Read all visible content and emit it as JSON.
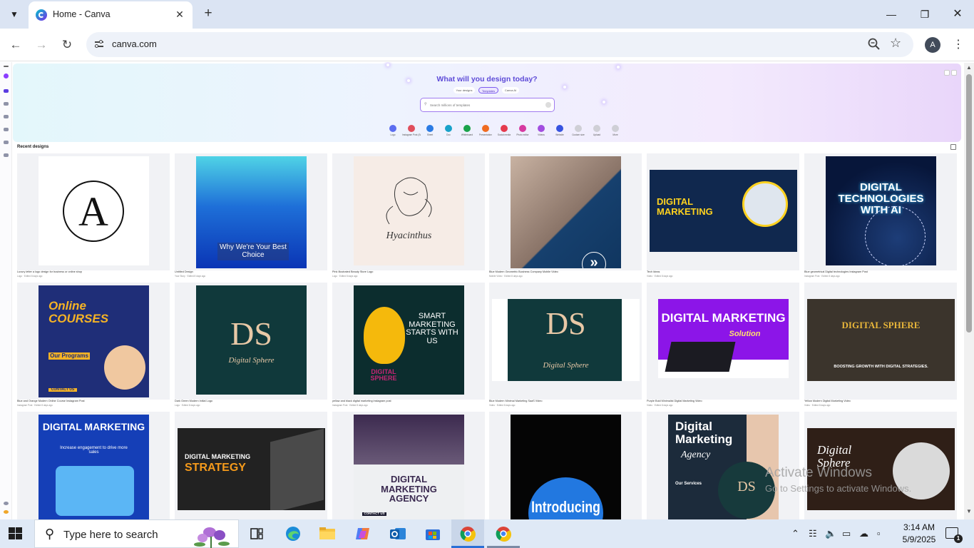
{
  "browser": {
    "tab_title": "Home - Canva",
    "url": "canva.com",
    "avatar_letter": "A"
  },
  "hero": {
    "heading": "What will you design today?",
    "tabs": [
      "Your designs",
      "Templates",
      "Canva AI"
    ],
    "search_placeholder": "Search millions of templates",
    "categories": [
      {
        "label": "Logo",
        "color": "#5b6df0"
      },
      {
        "label": "Instagram Post (Square)",
        "color": "#e04e5c"
      },
      {
        "label": "Sheet",
        "color": "#2a7be4"
      },
      {
        "label": "Doc",
        "color": "#17a2c9"
      },
      {
        "label": "Whiteboard",
        "color": "#1aa34a"
      },
      {
        "label": "Presentation",
        "color": "#f06b20"
      },
      {
        "label": "Social media",
        "color": "#e53a4d"
      },
      {
        "label": "Photo editor",
        "color": "#d63aa0"
      },
      {
        "label": "Videos",
        "color": "#a24ee0"
      },
      {
        "label": "Website",
        "color": "#3653e0"
      },
      {
        "label": "Custom size",
        "color": "#cfcfd6"
      },
      {
        "label": "Upload",
        "color": "#cfcfd6"
      },
      {
        "label": "More",
        "color": "#cfcfd6"
      }
    ]
  },
  "recent": {
    "title": "Recent designs",
    "designs": [
      {
        "name": "Luxury letter a logo design for business or online shop",
        "meta": "Logo · Edited 8 days ago",
        "art": "monogram-a"
      },
      {
        "name": "Untitled Design",
        "meta": "Your Story · Edited 8 days ago",
        "art": "blue-gradient",
        "caption": "Why We're Your Best Choice"
      },
      {
        "name": "Pink Illustrated Beauty Store Logo",
        "meta": "Logo · Edited 8 days ago",
        "art": "sketch",
        "signature": "Hyacinthus"
      },
      {
        "name": "Blue Modern Geometric Business Company Mobile Video",
        "meta": "Mobile Video · Edited 8 days ago",
        "art": "laptop-hands"
      },
      {
        "name": "Tech Ideas",
        "meta": "Video · Edited 8 days ago",
        "art": "dm-navy",
        "caption": "DIGITAL MARKETING"
      },
      {
        "name": "Blue geometrical Digital technologies Instagram Post",
        "meta": "Instagram Post · Edited 8 days ago",
        "art": "globe",
        "caption": "DIGITAL TECHNOLOGIES WITH AI"
      },
      {
        "name": "Blue and Orange Modern Online Course Instagram Post",
        "meta": "Instagram Post · Edited 8 days ago",
        "art": "online-courses",
        "caption": "Online COURSES",
        "sub": "Our Programs",
        "cta": "CONTACT US"
      },
      {
        "name": "Dark Green Modern Initial Logo",
        "meta": "Logo · Edited 8 days ago",
        "art": "ds-logo",
        "caption": "Digital Sphere"
      },
      {
        "name": "yellow and black digital marketing instagram post",
        "meta": "Instagram Post · Edited 8 days ago",
        "art": "bulb",
        "caption": "SMART MARKETING STARTS WITH US",
        "sub": "DIGITAL SPHERE"
      },
      {
        "name": "Blue Modern Minimal Marketing SaaS Video",
        "meta": "Video · Edited 8 days ago",
        "art": "ds-wide",
        "caption": "Digital Sphere"
      },
      {
        "name": "Purple Bold Minimalist Digital Marketing Video",
        "meta": "Video · Edited 8 days ago",
        "art": "purple-laptop",
        "caption": "DIGITAL MARKETING",
        "sub": "Solution"
      },
      {
        "name": "Yellow Modern Digital Marketing Video",
        "meta": "Video · Edited 8 days ago",
        "art": "gold-dark",
        "caption": "DIGITAL SPHERE",
        "sub": "BOOSTING GROWTH WITH DIGITAL STRATEGIES."
      },
      {
        "name": "",
        "meta": "",
        "art": "dm-blue",
        "caption": "DIGITAL MARKETING",
        "sub": "Increase engagement to drive more sales"
      },
      {
        "name": "",
        "meta": "",
        "art": "strategy",
        "caption": "DIGITAL MARKETING",
        "sub": "STRATEGY"
      },
      {
        "name": "",
        "meta": "",
        "art": "handshake",
        "caption": "DIGITAL MARKETING AGENCY",
        "cta": "CONTACT US"
      },
      {
        "name": "",
        "meta": "",
        "art": "introducing",
        "caption": "Introducing"
      },
      {
        "name": "",
        "meta": "",
        "art": "agency",
        "caption": "Digital Marketing",
        "sub": "Agency",
        "cta": "Our Services"
      },
      {
        "name": "",
        "meta": "",
        "art": "sphere-brown",
        "caption": "Digital Sphere"
      }
    ]
  },
  "watermark": {
    "line1": "Activate Windows",
    "line2": "Go to Settings to activate Windows."
  },
  "taskbar": {
    "search_placeholder": "Type here to search",
    "time": "3:14 AM",
    "date": "5/9/2025",
    "notification_count": "1"
  }
}
